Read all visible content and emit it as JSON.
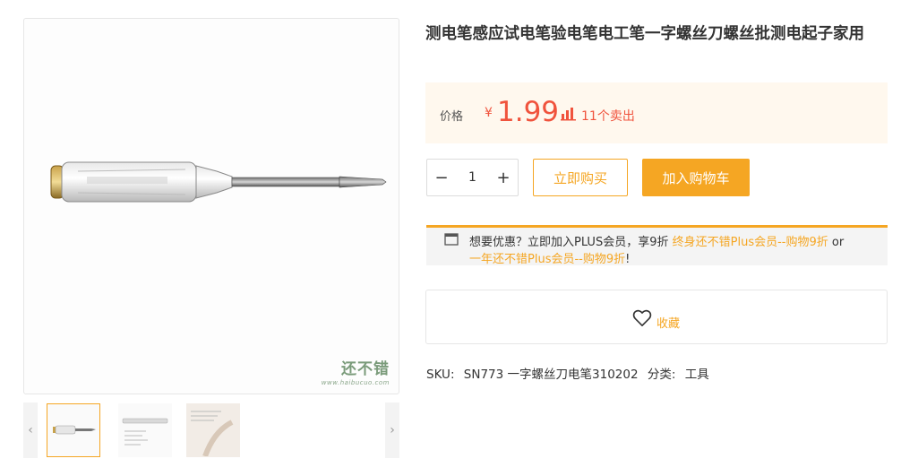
{
  "gallery": {
    "watermark_text": "还不错",
    "watermark_sub": "www.haibucuo.com",
    "prev_icon": "chevron-left-icon",
    "next_icon": "chevron-right-icon",
    "prev_glyph": "‹",
    "next_glyph": "›"
  },
  "product": {
    "title": "测电笔感应试电笔验电笔电工笔一字螺丝刀螺丝批测电起子家用"
  },
  "price": {
    "label": "价格",
    "currency": "¥",
    "value": "1.99",
    "sales_icon": "bar-chart-icon",
    "sales_text": "11个卖出"
  },
  "quantity": {
    "minus": "−",
    "value": "1",
    "plus": "+"
  },
  "actions": {
    "buy_now": "立即购买",
    "add_to_cart": "加入购物车"
  },
  "plus_promo": {
    "icon": "card-icon",
    "text_1": "想要优惠？立即加入PLUS会员，享9折",
    "link_1": "终身还不错Plus会员--购物9折",
    "or": "or",
    "link_2": "一年还不错Plus会员--购物9折",
    "exclaim": "!"
  },
  "favorite": {
    "icon": "heart-icon",
    "label": "收藏"
  },
  "meta": {
    "sku_label": "SKU:",
    "sku_value": "SN773 一字螺丝刀电笔310202",
    "category_label": "分类:",
    "category_value": "工具"
  },
  "colors": {
    "accent": "#f5a623",
    "price": "#f0533d",
    "price_bg": "#fff8ee"
  }
}
